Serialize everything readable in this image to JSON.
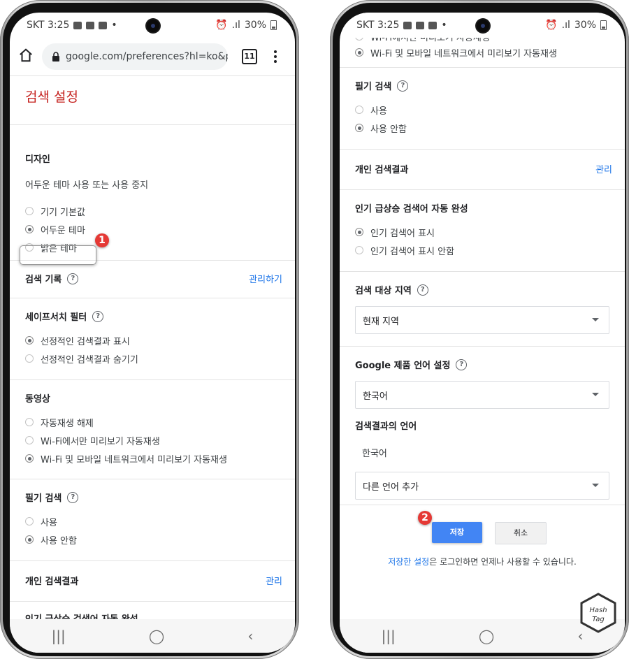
{
  "status": {
    "carrier_time": "SKT 3:25",
    "battery": "30%"
  },
  "browser": {
    "url": "google.com/preferences?hl=ko&prev=h",
    "tab_count": "11"
  },
  "left": {
    "page_title": "검색 설정",
    "design": {
      "title": "디자인",
      "description": "어두운 테마 사용 또는 사용 중지",
      "options": [
        "기기 기본값",
        "어두운 테마",
        "밝은 테마"
      ],
      "selected": 1
    },
    "search_history": {
      "title": "검색 기록",
      "link": "관리하기"
    },
    "safesearch": {
      "title": "세이프서치 필터",
      "options": [
        "선정적인 검색결과 표시",
        "선정적인 검색결과 숨기기"
      ],
      "selected": 0
    },
    "video": {
      "title": "동영상",
      "options": [
        "자동재생 해제",
        "Wi-Fi에서만 미리보기 자동재생",
        "Wi-Fi 및 모바일 네트워크에서 미리보기 자동재생"
      ],
      "selected": 2
    },
    "handwriting": {
      "title": "필기 검색",
      "options": [
        "사용",
        "사용 안함"
      ],
      "selected": 1
    },
    "personal": {
      "title": "개인 검색결과",
      "link": "관리"
    },
    "trending": {
      "title": "인기 급상승 검색어 자동 완성"
    }
  },
  "right": {
    "video_partial": {
      "cut_option": "Wi-Fi에서만 미리보기 자동재생",
      "option": "Wi-Fi 및 모바일 네트워크에서 미리보기 자동재생"
    },
    "handwriting": {
      "title": "필기 검색",
      "options": [
        "사용",
        "사용 안함"
      ],
      "selected": 1
    },
    "personal": {
      "title": "개인 검색결과",
      "link": "관리"
    },
    "trending": {
      "title": "인기 급상승 검색어 자동 완성",
      "options": [
        "인기 검색어 표시",
        "인기 검색어 표시 안함"
      ],
      "selected": 0
    },
    "region": {
      "title": "검색 대상 지역",
      "value": "현재 지역"
    },
    "product_language": {
      "title": "Google 제품 언어 설정",
      "value": "한국어"
    },
    "results_language": {
      "title": "검색결과의 언어",
      "current": "한국어",
      "add_placeholder": "다른 언어 추가"
    },
    "save_label": "저장",
    "cancel_label": "취소",
    "footnote_link": "저장한 설정",
    "footnote_rest": "은 로그인하면 언제나 사용할 수 있습니다."
  },
  "annotations": {
    "step1": "1",
    "step2": "2"
  },
  "navbar": {
    "recent": "|||",
    "home": "◯",
    "back": "‹"
  },
  "watermark": {
    "line1": "Hash",
    "line2": "Tag"
  }
}
